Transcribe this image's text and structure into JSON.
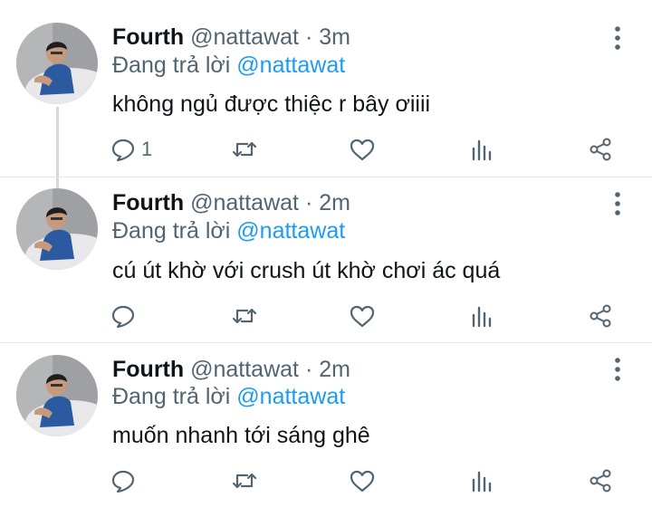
{
  "tweets": [
    {
      "name": "Fourth",
      "handle": "@nattawat",
      "separator": "·",
      "time": "3m",
      "reply_prefix": "Đang trả lời",
      "reply_to": "@nattawat",
      "text": "không ngủ được thiệc r bây ơiiii",
      "reply_count": "1"
    },
    {
      "name": "Fourth",
      "handle": "@nattawat",
      "separator": "·",
      "time": "2m",
      "reply_prefix": "Đang trả lời",
      "reply_to": "@nattawat",
      "text": "cú út khờ với crush út khờ chơi ác quá",
      "reply_count": ""
    },
    {
      "name": "Fourth",
      "handle": "@nattawat",
      "separator": "·",
      "time": "2m",
      "reply_prefix": "Đang trả lời",
      "reply_to": "@nattawat",
      "text": "muốn nhanh tới sáng ghê",
      "reply_count": ""
    }
  ],
  "icons": {
    "avatar": "avatar-photo",
    "more": "more-vertical-icon",
    "reply": "reply-icon",
    "retweet": "retweet-icon",
    "like": "heart-icon",
    "stats": "stats-icon",
    "share": "share-icon"
  },
  "colors": {
    "text": "#0f1419",
    "secondary": "#536471",
    "mention": "#1d9bf0",
    "divider": "#e1e4e7",
    "thread_line": "#cfd9de"
  }
}
